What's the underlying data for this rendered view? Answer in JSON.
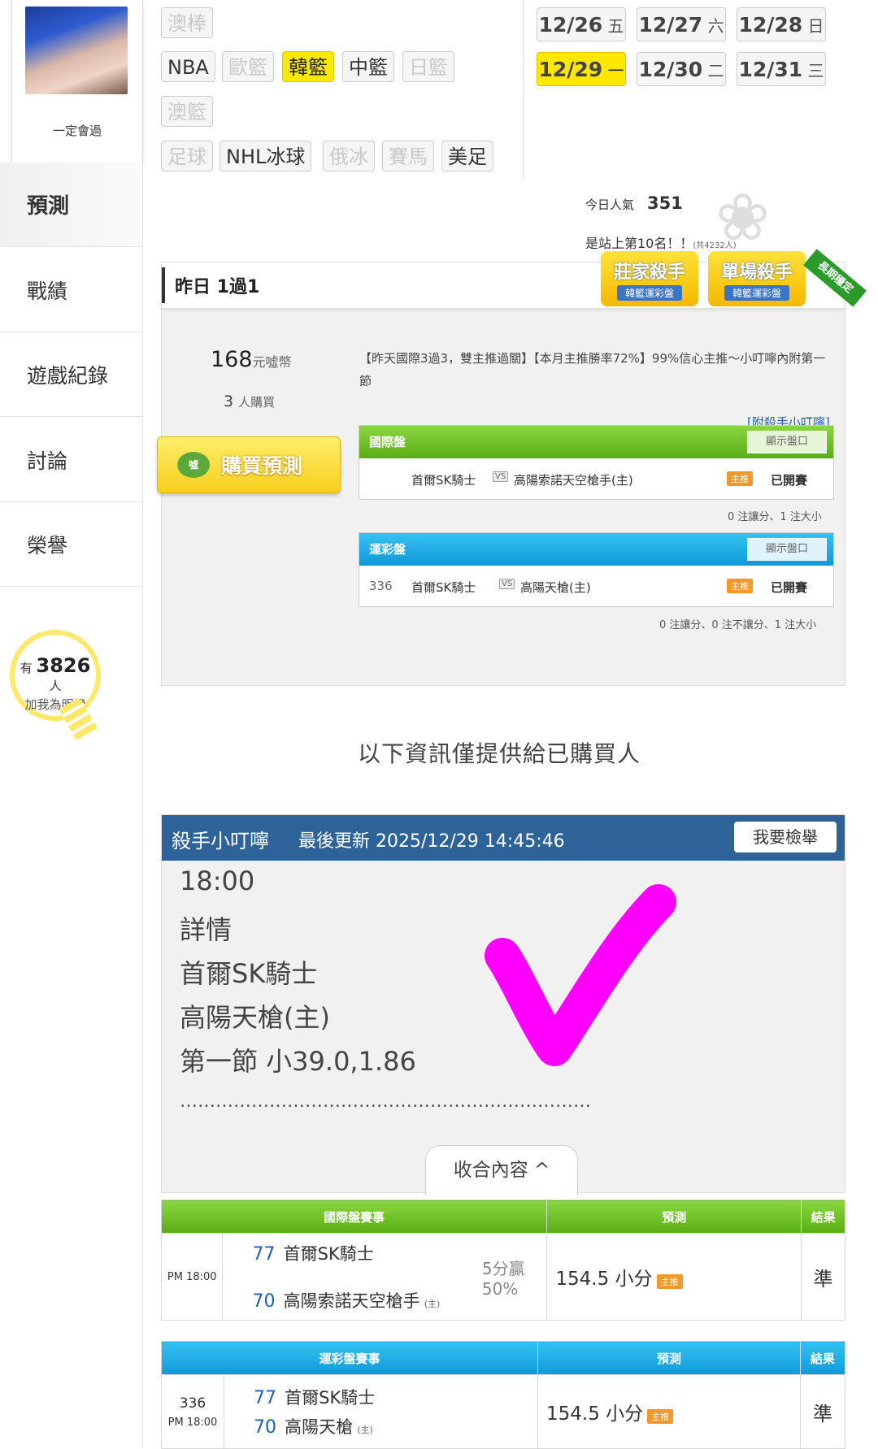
{
  "profile": {
    "name": "一定會過"
  },
  "nav": [
    {
      "label": "預測",
      "active": true
    },
    {
      "label": "戰績"
    },
    {
      "label": "遊戲紀錄"
    },
    {
      "label": "討論"
    },
    {
      "label": "榮譽"
    }
  ],
  "fans": {
    "prefix": "有",
    "count": "3826",
    "suffix": "人",
    "label": "加我為明燈"
  },
  "leagues": [
    "澳棒",
    "NBA",
    "歐籃",
    "韓籃",
    "中籃",
    "日籃",
    "澳籃",
    "足球",
    "NHL冰球",
    "俄冰",
    "賽馬",
    "美足"
  ],
  "dates": [
    {
      "md": "12/26",
      "dow": "五"
    },
    {
      "md": "12/27",
      "dow": "六"
    },
    {
      "md": "12/28",
      "dow": "日"
    },
    {
      "md": "12/29",
      "dow": "一"
    },
    {
      "md": "12/30",
      "dow": "二"
    },
    {
      "md": "12/31",
      "dow": "三"
    }
  ],
  "popularity": {
    "label": "今日人氣",
    "value": "351",
    "rank": "是站上第10名！！",
    "total": "(共4232人)"
  },
  "panel": {
    "title": "昨日 1過1",
    "badge1_main": "莊家殺手",
    "badge1_sub": "韓籃運彩盤",
    "badge2_main": "單場殺手",
    "badge2_sub": "韓籃運彩盤",
    "ribbon": "長期穩定",
    "price": "168",
    "price_unit": "元噓幣",
    "buyers": "3",
    "buyers_unit": "人購買",
    "buy_label": "購買預測",
    "coin": "噓",
    "description": "【昨天國際3過3，雙主推過關】【本月主推勝率72%】99%信心主推～小叮嚀內附第一節",
    "attach": "[附殺手小叮嚀]"
  },
  "intl_box": {
    "title": "國際盤",
    "show": "顯示盤口",
    "away": "首爾SK騎士",
    "vs": "VS",
    "home": "高陽索諾天空槍手(主)",
    "tag": "主推",
    "status": "已開賽",
    "note": "0 注讓分、1 注大小"
  },
  "lottery_box": {
    "title": "運彩盤",
    "show": "顯示盤口",
    "no": "336",
    "away": "首爾SK騎士",
    "vs": "VS",
    "home": "高陽天槍(主)",
    "tag": "主推",
    "status": "已開賽",
    "note": "0 注讓分、0 注不讓分、1 注大小"
  },
  "info_line": "以下資訊僅提供給已購買人",
  "detail": {
    "author": "殺手小叮嚀",
    "updated": "最後更新 2025/12/29 14:45:46",
    "report": "我要檢舉",
    "lines": [
      "18:00",
      "詳情",
      "首爾SK騎士",
      "高陽天槍(主)",
      "第一節 小39.0,1.86"
    ],
    "dots": "……………………………………………………………",
    "collapse": "收合內容 ^",
    "mark_color": "#ff00ff"
  },
  "intl_table": {
    "headers": [
      "國際盤賽事",
      "預測",
      "結果"
    ],
    "time": "PM 18:00",
    "away_score": "77",
    "away": "首爾SK騎士",
    "home_score": "70",
    "home": "高陽索諾天空槍手",
    "host": "(主)",
    "spread": "5分贏",
    "pct": "50%",
    "pred": "154.5 小分",
    "tag": "主推",
    "result": "準"
  },
  "lottery_table": {
    "headers": [
      "運彩盤賽事",
      "預測",
      "結果"
    ],
    "no": "336",
    "time": "PM 18:00",
    "away_score": "77",
    "away": "首爾SK騎士",
    "home_score": "70",
    "home": "高陽天槍",
    "host": "(主)",
    "pred": "154.5 小分",
    "tag": "主推",
    "result": "準"
  },
  "colors": {
    "accent_yellow": "#ffe800",
    "green_header": "#5aad15",
    "blue_header": "#0f98d8",
    "detail_header": "#2e6399",
    "check": "#ff00ff"
  }
}
